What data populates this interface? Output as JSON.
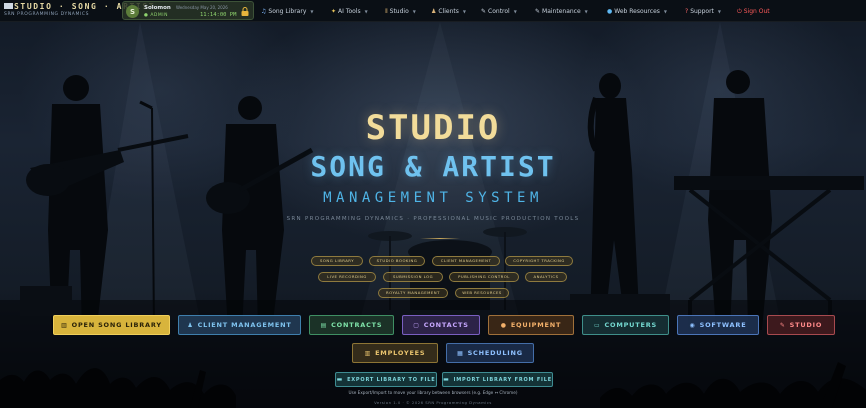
{
  "brand": {
    "title": "STUDIO · SONG · ARTIST",
    "subtitle": "SRN PROGRAMMING DYNAMICS"
  },
  "user": {
    "initial": "S",
    "name": "Solomon",
    "role": "● ADMIN",
    "date": "Wednesday May 20, 2026",
    "time": "11:14:00 PM"
  },
  "nav": [
    {
      "icon": "♫",
      "icon_name": "music-note-icon",
      "label": "Song Library"
    },
    {
      "icon": "✦",
      "icon_name": "sparkle-icon",
      "label": "AI Tools"
    },
    {
      "icon": "⦀",
      "icon_name": "studio-bars-icon",
      "label": "Studio"
    },
    {
      "icon": "♟",
      "icon_name": "person-icon",
      "label": "Clients"
    },
    {
      "icon": "✎",
      "icon_name": "pen-icon",
      "label": "Control"
    },
    {
      "icon": "✎",
      "icon_name": "wrench-icon",
      "label": "Maintenance"
    },
    {
      "icon": "●",
      "icon_name": "globe-icon",
      "label": "Web Resources"
    },
    {
      "icon": "?",
      "icon_name": "question-icon",
      "label": "Support"
    }
  ],
  "signout": {
    "icon": "⏻",
    "label": "Sign Out"
  },
  "hero": {
    "line1": "STUDIO",
    "line2": "SONG & ARTIST",
    "line3": "MANAGEMENT SYSTEM",
    "tagline": "SRN PROGRAMMING DYNAMICS · PROFESSIONAL MUSIC PRODUCTION TOOLS"
  },
  "chips": [
    "SONG LIBRARY",
    "STUDIO BOOKING",
    "CLIENT MANAGEMENT",
    "COPYRIGHT TRACKING",
    "LIVE RECORDING",
    "SUBMISSION LOG",
    "PUBLISHING CONTROL",
    "ANALYTICS",
    "ROYALTY MANAGEMENT",
    "WEB RESOURCES"
  ],
  "actions": [
    {
      "icon": "▥",
      "label": "OPEN SONG LIBRARY"
    },
    {
      "icon": "♟",
      "label": "CLIENT MANAGEMENT"
    },
    {
      "icon": "▤",
      "label": "CONTRACTS"
    },
    {
      "icon": "▢",
      "label": "CONTACTS"
    },
    {
      "icon": "●",
      "label": "EQUIPMENT"
    },
    {
      "icon": "▭",
      "label": "COMPUTERS"
    },
    {
      "icon": "◉",
      "label": "SOFTWARE"
    },
    {
      "icon": "✎",
      "label": "STUDIO"
    }
  ],
  "actions2": [
    {
      "icon": "▥",
      "label": "EMPLOYEES"
    },
    {
      "icon": "▦",
      "label": "SCHEDULING"
    }
  ],
  "export": {
    "icon": "▬",
    "label": "EXPORT LIBRARY TO FILE"
  },
  "import": {
    "icon": "▬",
    "label": "IMPORT LIBRARY FROM FILE"
  },
  "note": "Use Export/Import to move your library between browsers (e.g. Edge ↔ Chrome)",
  "version": "Version 1.0 · © 2026 SRN Programming Dynamics",
  "colors": {
    "gold": "#d8b43c",
    "sky": "#6fc2ef",
    "signout": "#ff5a5a",
    "accent_green": "#8fd46e"
  }
}
